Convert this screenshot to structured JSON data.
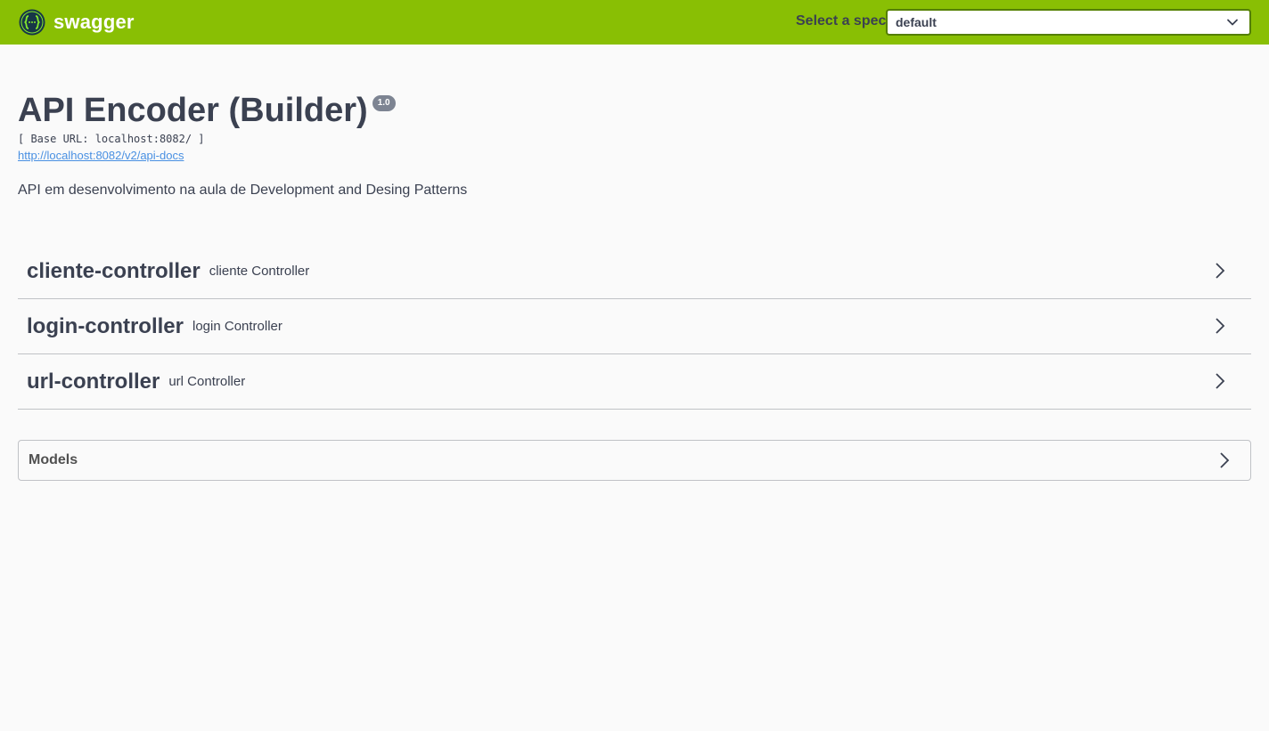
{
  "topbar": {
    "logo_text": "swagger",
    "logo_icon": "swagger-logo-icon",
    "spec_label": "Select a spec",
    "spec_value": "default",
    "background_color": "#89bf04"
  },
  "info": {
    "title": "API Encoder (Builder)",
    "version": "1.0",
    "base_url": "[ Base URL: localhost:8082/ ]",
    "docs_link": "http://localhost:8082/v2/api-docs",
    "description": "API em desenvolvimento na aula de Development and Desing Patterns"
  },
  "tags": [
    {
      "name": "cliente-controller",
      "description": "cliente Controller"
    },
    {
      "name": "login-controller",
      "description": "login Controller"
    },
    {
      "name": "url-controller",
      "description": "url Controller"
    }
  ],
  "models": {
    "title": "Models"
  }
}
